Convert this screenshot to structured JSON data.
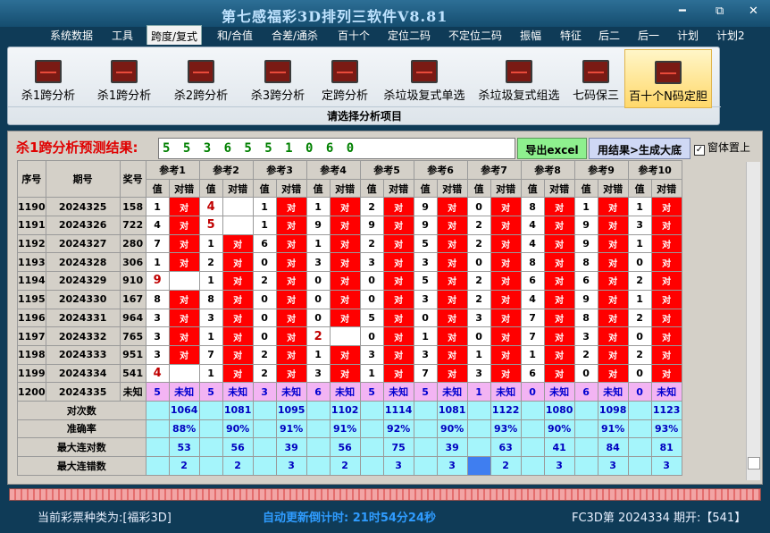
{
  "app": {
    "title": "第七感福彩3D排列三软件V8.81"
  },
  "window_controls": [
    "━",
    "⧉",
    "✕"
  ],
  "menu": [
    "系统数据",
    "工具",
    "跨度/复式",
    "和/合值",
    "合差/通杀",
    "百十个",
    "定位二码",
    "不定位二码",
    "振幅",
    "特征",
    "后二",
    "后一",
    "计划",
    "计划2"
  ],
  "menu_active": 2,
  "ribbon": {
    "buttons": [
      "杀1跨分析",
      "杀1跨分析",
      "杀2跨分析",
      "杀3跨分析",
      "定跨分析",
      "杀垃圾复式单选",
      "杀垃圾复式组选",
      "七码保三",
      "百十个N码定胆"
    ],
    "active": 8,
    "caption": "请选择分析项目"
  },
  "prediction": {
    "label": "杀1跨分析预测结果:",
    "value": "5 5 3 6 5 5 1 0 6 0"
  },
  "buttons": {
    "export": "导出excel",
    "generate": "用结果>生成大底"
  },
  "checkbox": {
    "label": "窗体置上",
    "checked": true,
    "mark": "✓"
  },
  "table": {
    "headers": [
      "序号",
      "期号",
      "奖号"
    ],
    "ref_headers": [
      "参考1",
      "参考2",
      "参考3",
      "参考4",
      "参考5",
      "参考6",
      "参考7",
      "参考8",
      "参考9",
      "参考10"
    ],
    "sub_headers": [
      "值",
      "对错"
    ],
    "hit_text": "对",
    "unknown_text": "未知",
    "rows": [
      {
        "no": "1190",
        "issue": "2024325",
        "prize": "158",
        "vals": [
          "1",
          "4",
          "1",
          "1",
          "2",
          "9",
          "0",
          "8",
          "1",
          "1"
        ],
        "hits": [
          1,
          0,
          1,
          1,
          1,
          1,
          1,
          1,
          1,
          1
        ],
        "miss": [
          0,
          1,
          0,
          0,
          0,
          0,
          0,
          0,
          0,
          0
        ]
      },
      {
        "no": "1191",
        "issue": "2024326",
        "prize": "722",
        "vals": [
          "4",
          "5",
          "1",
          "9",
          "9",
          "9",
          "2",
          "4",
          "9",
          "3"
        ],
        "hits": [
          1,
          0,
          1,
          1,
          1,
          1,
          1,
          1,
          1,
          1
        ],
        "miss": [
          0,
          1,
          0,
          0,
          0,
          0,
          0,
          0,
          0,
          0
        ]
      },
      {
        "no": "1192",
        "issue": "2024327",
        "prize": "280",
        "vals": [
          "7",
          "1",
          "6",
          "1",
          "2",
          "5",
          "2",
          "4",
          "9",
          "1"
        ],
        "hits": [
          1,
          1,
          1,
          1,
          1,
          1,
          1,
          1,
          1,
          1
        ],
        "miss": [
          0,
          0,
          0,
          0,
          0,
          0,
          0,
          0,
          0,
          0
        ]
      },
      {
        "no": "1193",
        "issue": "2024328",
        "prize": "306",
        "vals": [
          "1",
          "2",
          "0",
          "3",
          "3",
          "3",
          "0",
          "8",
          "8",
          "0"
        ],
        "hits": [
          1,
          1,
          1,
          1,
          1,
          1,
          1,
          1,
          1,
          1
        ],
        "miss": [
          0,
          0,
          0,
          0,
          0,
          0,
          0,
          0,
          0,
          0
        ]
      },
      {
        "no": "1194",
        "issue": "2024329",
        "prize": "910",
        "vals": [
          "9",
          "1",
          "2",
          "0",
          "0",
          "5",
          "2",
          "6",
          "6",
          "2"
        ],
        "hits": [
          0,
          1,
          1,
          1,
          1,
          1,
          1,
          1,
          1,
          1
        ],
        "miss": [
          1,
          0,
          0,
          0,
          0,
          0,
          0,
          0,
          0,
          0
        ]
      },
      {
        "no": "1195",
        "issue": "2024330",
        "prize": "167",
        "vals": [
          "8",
          "8",
          "0",
          "0",
          "0",
          "3",
          "2",
          "4",
          "9",
          "1"
        ],
        "hits": [
          1,
          1,
          1,
          1,
          1,
          1,
          1,
          1,
          1,
          1
        ],
        "miss": [
          0,
          0,
          0,
          0,
          0,
          0,
          0,
          0,
          0,
          0
        ]
      },
      {
        "no": "1196",
        "issue": "2024331",
        "prize": "964",
        "vals": [
          "3",
          "3",
          "0",
          "0",
          "5",
          "0",
          "3",
          "7",
          "8",
          "2"
        ],
        "hits": [
          1,
          1,
          1,
          1,
          1,
          1,
          1,
          1,
          1,
          1
        ],
        "miss": [
          0,
          0,
          0,
          0,
          0,
          0,
          0,
          0,
          0,
          0
        ]
      },
      {
        "no": "1197",
        "issue": "2024332",
        "prize": "765",
        "vals": [
          "3",
          "1",
          "0",
          "2",
          "0",
          "1",
          "0",
          "7",
          "3",
          "0"
        ],
        "hits": [
          1,
          1,
          1,
          0,
          1,
          1,
          1,
          1,
          1,
          1
        ],
        "miss": [
          0,
          0,
          0,
          1,
          0,
          0,
          0,
          0,
          0,
          0
        ]
      },
      {
        "no": "1198",
        "issue": "2024333",
        "prize": "951",
        "vals": [
          "3",
          "7",
          "2",
          "1",
          "3",
          "3",
          "1",
          "1",
          "2",
          "2"
        ],
        "hits": [
          1,
          1,
          1,
          1,
          1,
          1,
          1,
          1,
          1,
          1
        ],
        "miss": [
          0,
          0,
          0,
          0,
          0,
          0,
          0,
          0,
          0,
          0
        ]
      },
      {
        "no": "1199",
        "issue": "2024334",
        "prize": "541",
        "vals": [
          "4",
          "1",
          "2",
          "3",
          "1",
          "7",
          "3",
          "6",
          "0",
          "0"
        ],
        "hits": [
          0,
          1,
          1,
          1,
          1,
          1,
          1,
          1,
          1,
          1
        ],
        "miss": [
          1,
          0,
          0,
          0,
          0,
          0,
          0,
          0,
          0,
          0
        ]
      },
      {
        "no": "1200",
        "issue": "2024335",
        "prize": "未知",
        "vals": [
          "5",
          "5",
          "3",
          "6",
          "5",
          "5",
          "1",
          "0",
          "6",
          "0"
        ],
        "hits": [
          0,
          0,
          0,
          0,
          0,
          0,
          0,
          0,
          0,
          0
        ],
        "miss": [
          0,
          0,
          0,
          0,
          0,
          0,
          0,
          0,
          0,
          0
        ],
        "unknown": true
      }
    ],
    "stats": [
      {
        "label": "对次数",
        "vals": [
          "1064",
          "1081",
          "1095",
          "1102",
          "1114",
          "1081",
          "1122",
          "1080",
          "1098",
          "1123"
        ]
      },
      {
        "label": "准确率",
        "vals": [
          "88%",
          "90%",
          "91%",
          "91%",
          "92%",
          "90%",
          "93%",
          "90%",
          "91%",
          "93%"
        ]
      },
      {
        "label": "最大连对数",
        "vals": [
          "53",
          "56",
          "39",
          "56",
          "75",
          "39",
          "63",
          "41",
          "84",
          "81"
        ]
      },
      {
        "label": "最大连错数",
        "vals": [
          "2",
          "2",
          "3",
          "2",
          "3",
          "3",
          "2",
          "3",
          "3",
          "3"
        ]
      }
    ]
  },
  "status": {
    "left": "当前彩票种类为:[福彩3D]",
    "middle": "自动更新倒计时: 21时54分24秒",
    "right": "FC3D第 2024334 期开:【541】"
  },
  "colors": {
    "hit": "#ff0000",
    "unknown": "#f3b4f3",
    "stat": "#a5f5fb",
    "highlight": "#3f7ef0"
  }
}
